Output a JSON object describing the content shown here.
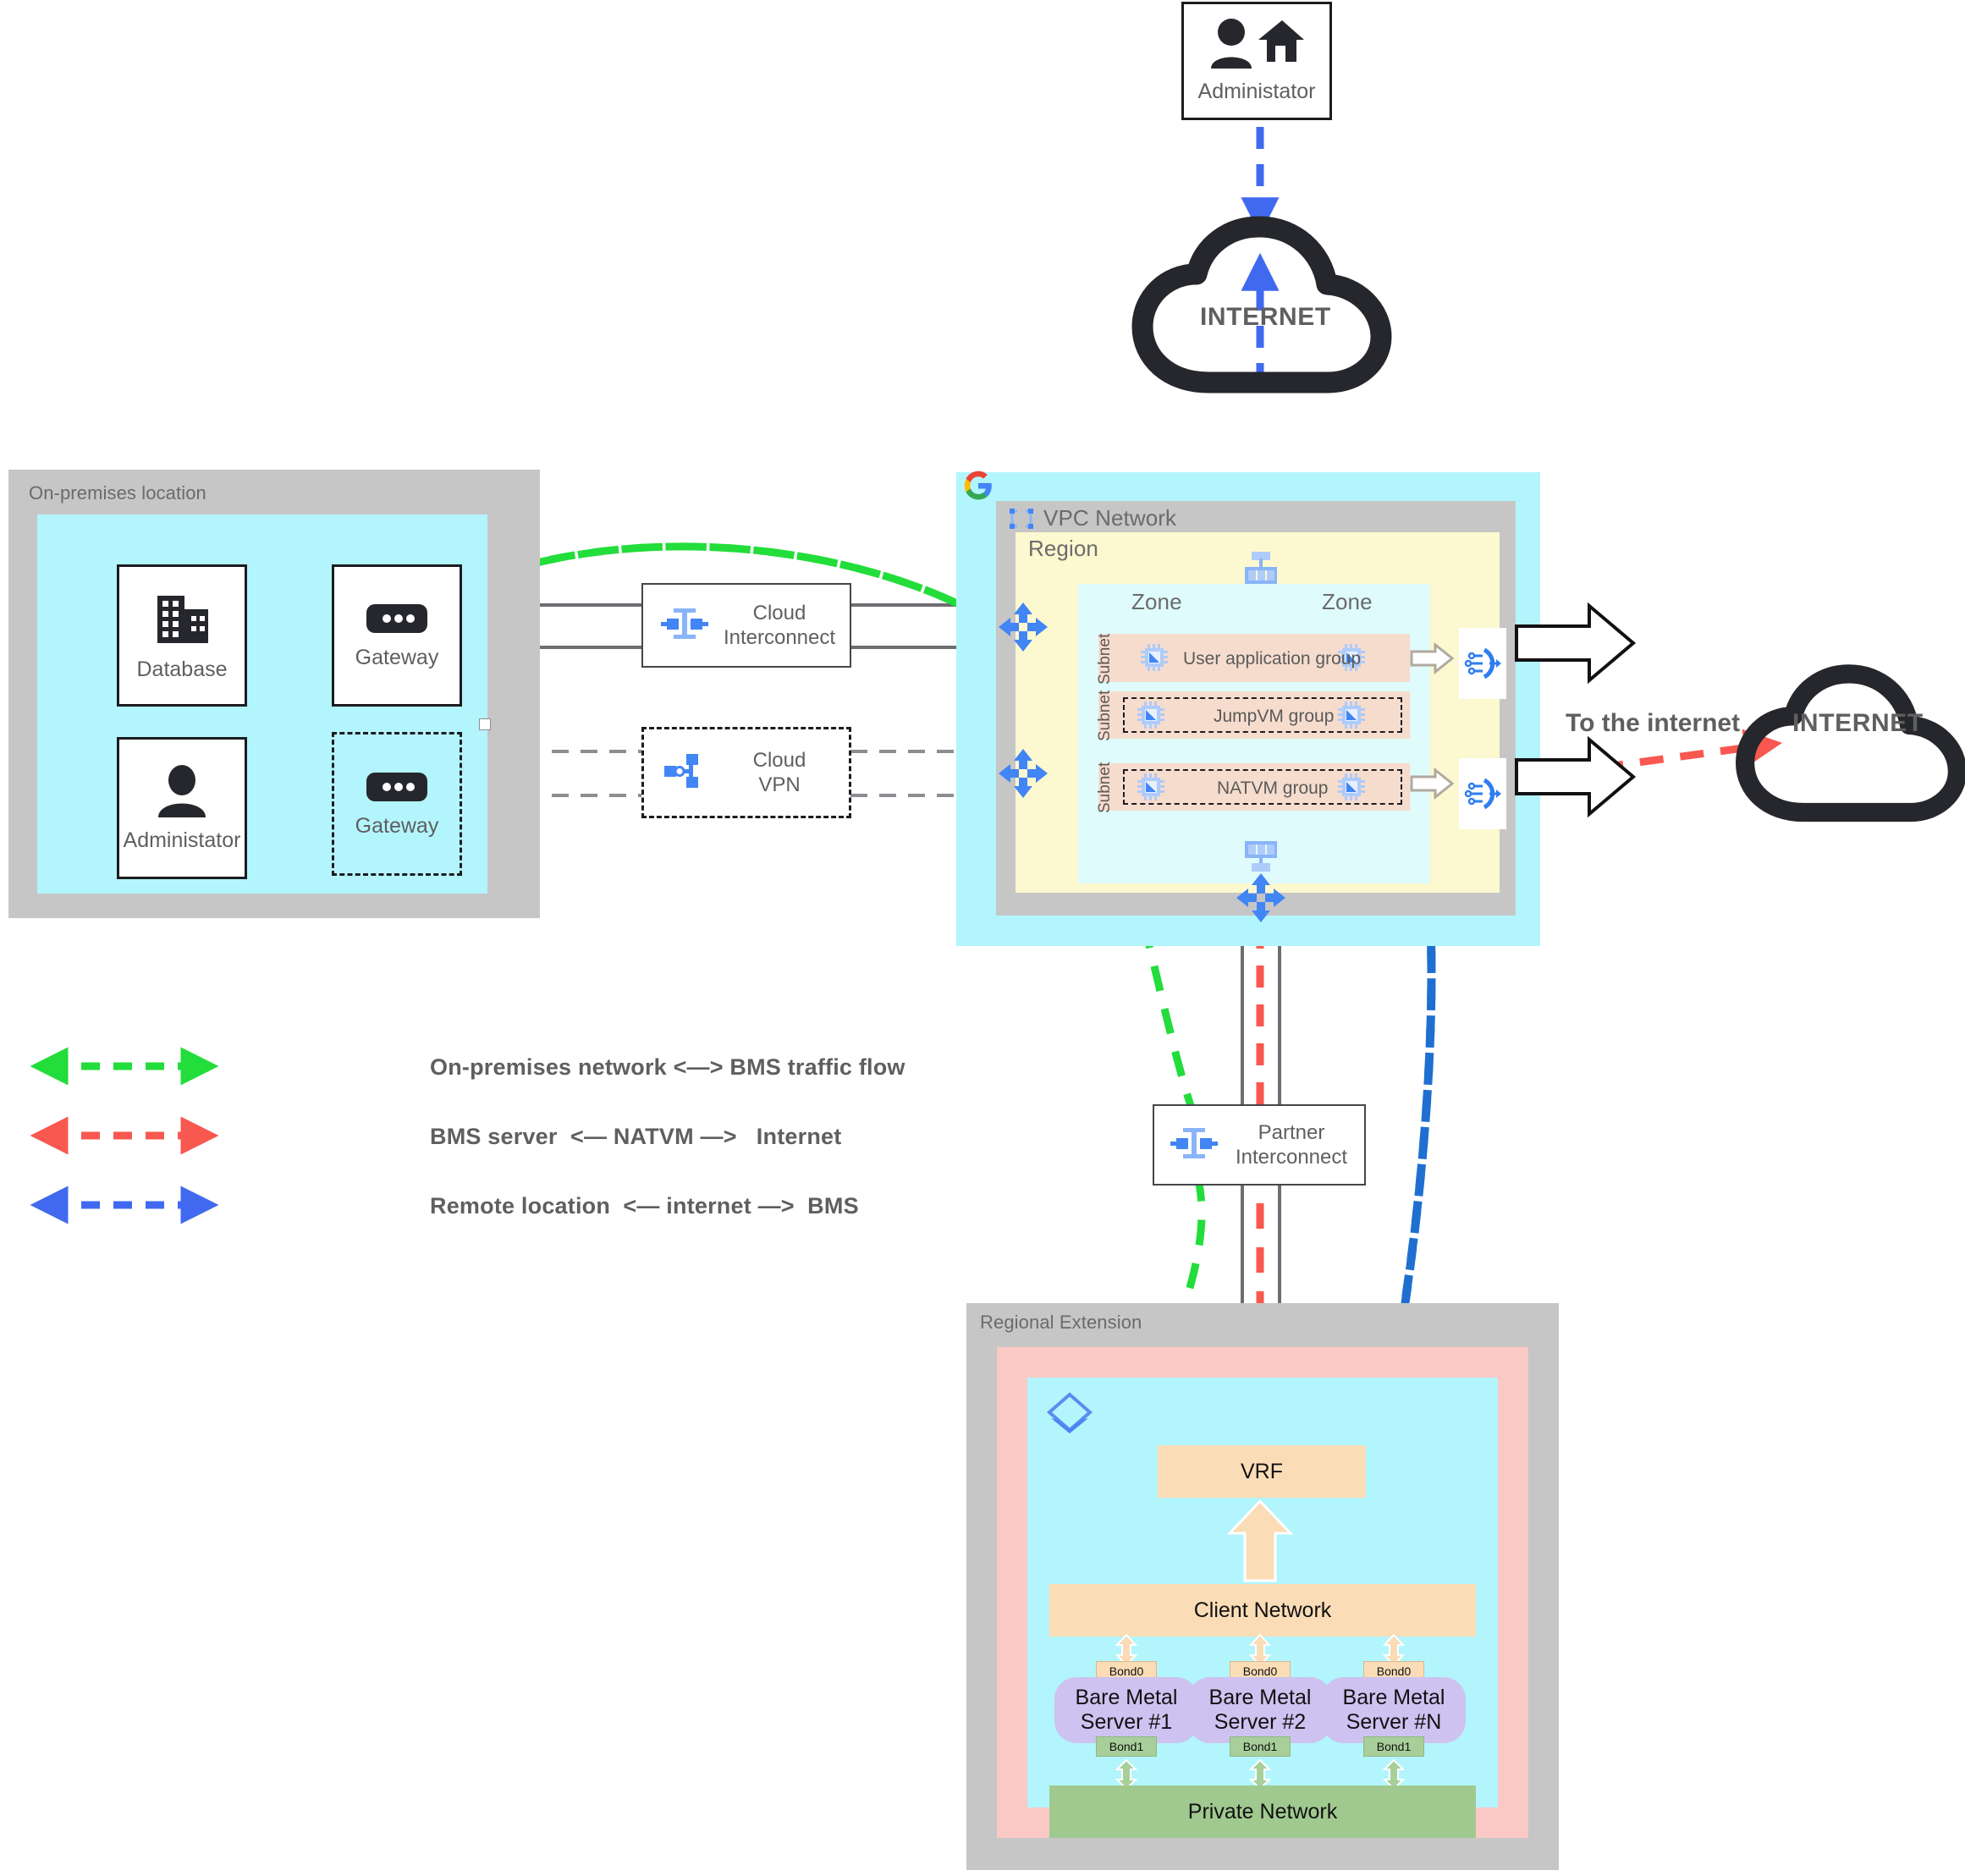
{
  "top_admin": {
    "label": "Administator",
    "icon": "user-home-icon"
  },
  "clouds": [
    {
      "name": "internet-cloud-top",
      "label": "INTERNET"
    },
    {
      "name": "internet-cloud-right",
      "label": "INTERNET"
    }
  ],
  "to_internet_label": "To the internet",
  "onprem": {
    "title": "On-premises location",
    "nodes": [
      {
        "name": "database",
        "label": "Database",
        "icon": "building-icon",
        "style": "solid"
      },
      {
        "name": "gateway-primary",
        "label": "Gateway",
        "icon": "router-icon",
        "style": "solid"
      },
      {
        "name": "administrator",
        "label": "Administator",
        "icon": "person-icon",
        "style": "solid"
      },
      {
        "name": "gateway-secondary",
        "label": "Gateway",
        "icon": "router-icon",
        "style": "dashed"
      }
    ]
  },
  "connectors": [
    {
      "name": "cloud-interconnect",
      "line1": "Cloud",
      "line2": "Interconnect",
      "icon": "interconnect-icon",
      "style": "solid"
    },
    {
      "name": "cloud-vpn",
      "line1": "Cloud",
      "line2": "VPN",
      "icon": "vpn-icon",
      "style": "dashed"
    },
    {
      "name": "partner-interconnect",
      "line1": "Partner",
      "line2": "Interconnect",
      "icon": "interconnect-icon",
      "style": "solid"
    }
  ],
  "vpc": {
    "title": "VPC Network",
    "icon": "vpc-icon",
    "brand_icon": "google-g-logo",
    "region_label": "Region",
    "zones": [
      "Zone",
      "Zone"
    ],
    "subnet_label": "Subnet",
    "groups": [
      {
        "name": "user-application-group",
        "label": "User application group",
        "style": "solid"
      },
      {
        "name": "jumpvm-group",
        "label": "JumpVM group",
        "style": "dashed"
      },
      {
        "name": "natvm-group",
        "label": "NATVM group",
        "style": "dashed"
      }
    ],
    "nat_gateways": [
      {
        "name": "cloud-nat-upper",
        "icon": "cloud-nat-icon"
      },
      {
        "name": "cloud-nat-lower",
        "icon": "cloud-nat-icon"
      }
    ],
    "routers": [
      {
        "name": "cloud-router-interconnect",
        "icon": "cloud-router-icon"
      },
      {
        "name": "cloud-router-vpn",
        "icon": "cloud-router-icon"
      },
      {
        "name": "cloud-router-partner",
        "icon": "cloud-router-icon"
      }
    ],
    "gateways": [
      {
        "name": "internet-gateway-top",
        "icon": "gateway-icon"
      },
      {
        "name": "internet-gateway-bottom",
        "icon": "gateway-icon"
      }
    ]
  },
  "regional_extension": {
    "title": "Regional Extension",
    "icon": "bare-metal-solution-icon",
    "vrf_label": "VRF",
    "client_network_label": "Client Network",
    "private_network_label": "Private Network",
    "bond_top_label": "Bond0",
    "bond_bottom_label": "Bond1",
    "servers": [
      {
        "name": "bare-metal-server-1",
        "line1": "Bare Metal",
        "line2": "Server #1"
      },
      {
        "name": "bare-metal-server-2",
        "line1": "Bare Metal",
        "line2": "Server #2"
      },
      {
        "name": "bare-metal-server-n",
        "line1": "Bare Metal",
        "line2": "Server #N"
      }
    ]
  },
  "legend": [
    {
      "name": "legend-onprem-bms",
      "color": "#22dd3a",
      "text": "On-premises network <—> BMS traffic flow"
    },
    {
      "name": "legend-bms-natvm-internet",
      "color": "#f8584f",
      "text": "BMS server  <— NATVM —>   Internet"
    },
    {
      "name": "legend-remote-internet-bms",
      "color": "#4169f0",
      "text": "Remote location  <— internet —>  BMS"
    }
  ],
  "colors": {
    "green_flow": "#22dd3a",
    "red_flow": "#f8584f",
    "blue_flow": "#1f6fd0",
    "gray_group": "#c6c6c6",
    "cyan": "#b3f5fc",
    "yellow": "#fcf8d0",
    "salmon": "#f6dccd",
    "pink": "#fbc9c5",
    "purple": "#cdc2f0",
    "orange": "#fadcb6",
    "green_band": "#a0c98f",
    "gcp_blue": "#4285f4"
  }
}
